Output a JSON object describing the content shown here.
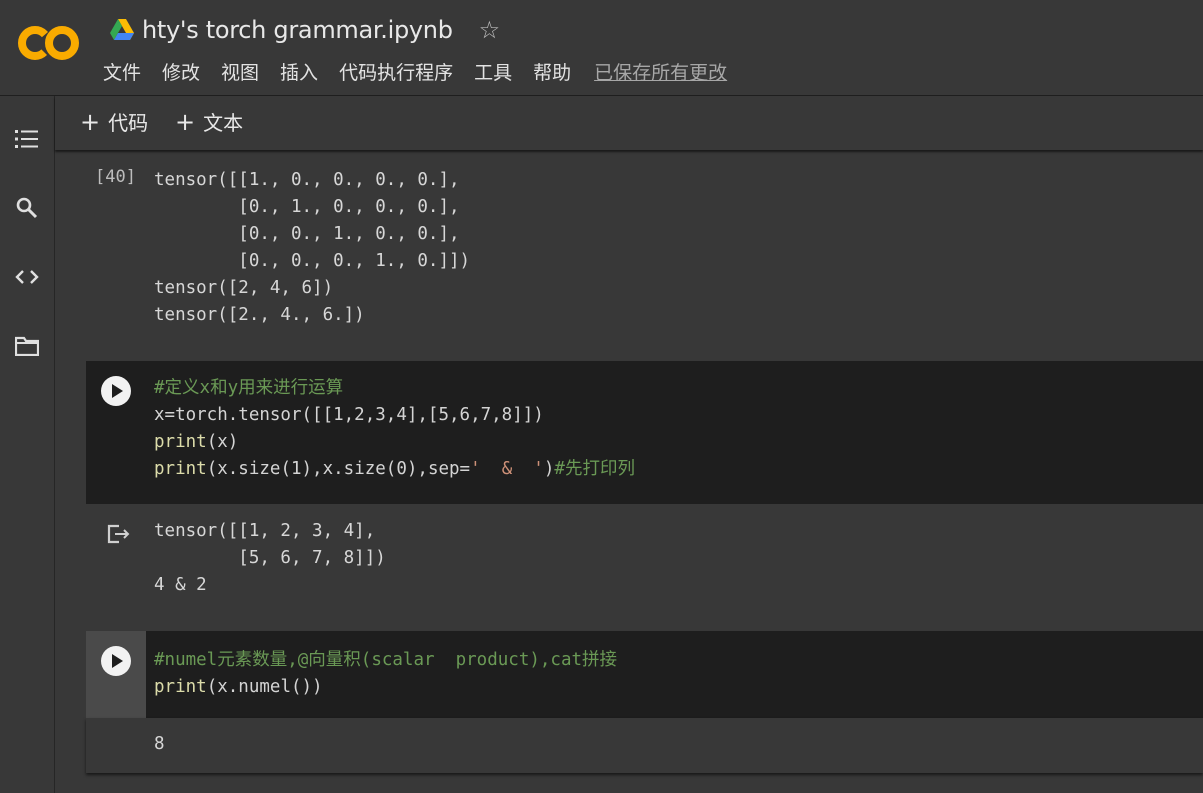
{
  "header": {
    "logo_text": "CO",
    "title": "hty's torch grammar.ipynb",
    "star_icon": "star-outline-icon",
    "menu": [
      "文件",
      "修改",
      "视图",
      "插入",
      "代码执行程序",
      "工具",
      "帮助"
    ],
    "saved_status": "已保存所有更改"
  },
  "sidebar": {
    "items": [
      {
        "icon": "table-of-contents-icon"
      },
      {
        "icon": "search-icon"
      },
      {
        "icon": "code-snippets-icon"
      },
      {
        "icon": "folder-icon"
      }
    ]
  },
  "toolbar": {
    "add_code_label": "代码",
    "add_text_label": "文本"
  },
  "cells": {
    "prev_output": {
      "exec_count": "[40]",
      "lines": [
        "tensor([[1., 0., 0., 0., 0.],",
        "        [0., 1., 0., 0., 0.],",
        "        [0., 0., 1., 0., 0.],",
        "        [0., 0., 0., 1., 0.]])",
        "tensor([2, 4, 6])",
        "tensor([2., 4., 6.])"
      ]
    },
    "cell1": {
      "comment": "#定义x和y用来进行运算",
      "line2": "x=torch.tensor([[1,2,3,4],[5,6,7,8]])",
      "line3_fn": "print",
      "line3_rest": "(x)",
      "line4_fn": "print",
      "line4_a": "(x.size(1),x.size(0),sep=",
      "line4_str": "'  &  '",
      "line4_b": ")",
      "line4_comment": "#先打印列",
      "output": [
        "tensor([[1, 2, 3, 4],",
        "        [5, 6, 7, 8]])",
        "4 & 2"
      ]
    },
    "cell2": {
      "comment": "#numel元素数量,@向量积(scalar  product),cat拼接",
      "line2_fn": "print",
      "line2_rest": "(x.numel())",
      "output": "8"
    }
  },
  "colors": {
    "background": "#383838",
    "code_background": "#1e1e1e",
    "comment": "#6a9955",
    "function": "#dcdcaa",
    "string": "#ce9178",
    "logo": "#f9ab00"
  }
}
